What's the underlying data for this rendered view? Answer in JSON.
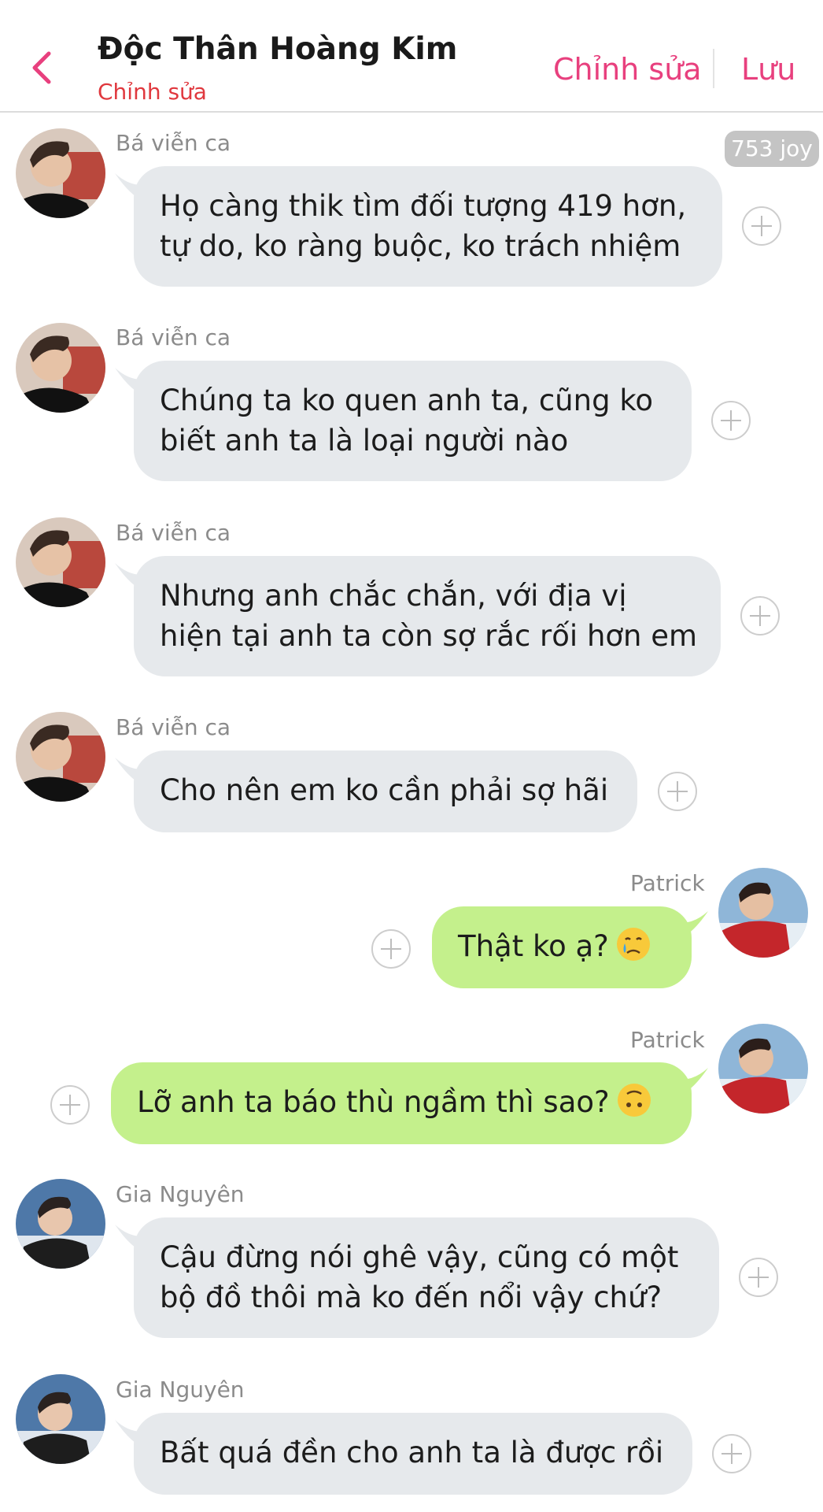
{
  "header": {
    "title": "Độc Thân Hoàng Kim",
    "subtitle": "Chỉnh sửa",
    "edit_label": "Chỉnh sửa",
    "save_label": "Lưu",
    "accent_color": "#e8407e"
  },
  "joy_badge": "753 joy",
  "messages": [
    {
      "sender": "Bá viễn ca",
      "lines": [
        "Họ càng thik tìm đối tượng 419 hơn,",
        "tự do, ko ràng buộc,  ko trách nhiệm"
      ],
      "side": "in"
    },
    {
      "sender": "Bá viễn ca",
      "lines": [
        "Chúng ta ko quen anh ta, cũng ko",
        "biết anh ta là loại người nào"
      ],
      "side": "in"
    },
    {
      "sender": "Bá viễn ca",
      "lines": [
        "Nhưng anh chắc chắn, với địa vị",
        "hiện tại anh ta còn sợ rắc rối hơn em"
      ],
      "side": "in"
    },
    {
      "sender": "Bá viễn ca",
      "lines": [
        "Cho nên em ko cần phải sợ hãi"
      ],
      "side": "in"
    },
    {
      "sender": "Patrick",
      "lines": [
        "Thật ko ạ?"
      ],
      "side": "out",
      "emoji": "crying-face-icon"
    },
    {
      "sender": "Patrick",
      "lines": [
        "Lỡ anh ta báo thù ngầm thì sao?"
      ],
      "side": "out",
      "emoji": "upside-down-face-icon"
    },
    {
      "sender": "Gia Nguyên",
      "lines": [
        "Cậu đừng nói ghê vậy, cũng có một",
        "bộ đồ thôi mà ko đến nổi vậy chứ?"
      ],
      "side": "in"
    },
    {
      "sender": "Gia Nguyên",
      "lines": [
        "Bất quá đền cho anh ta là được rồi"
      ],
      "side": "in"
    }
  ],
  "colors": {
    "incoming_bubble": "#e6e9ec",
    "outgoing_bubble": "#c4f08c",
    "sender_text": "#8b8b8b"
  }
}
